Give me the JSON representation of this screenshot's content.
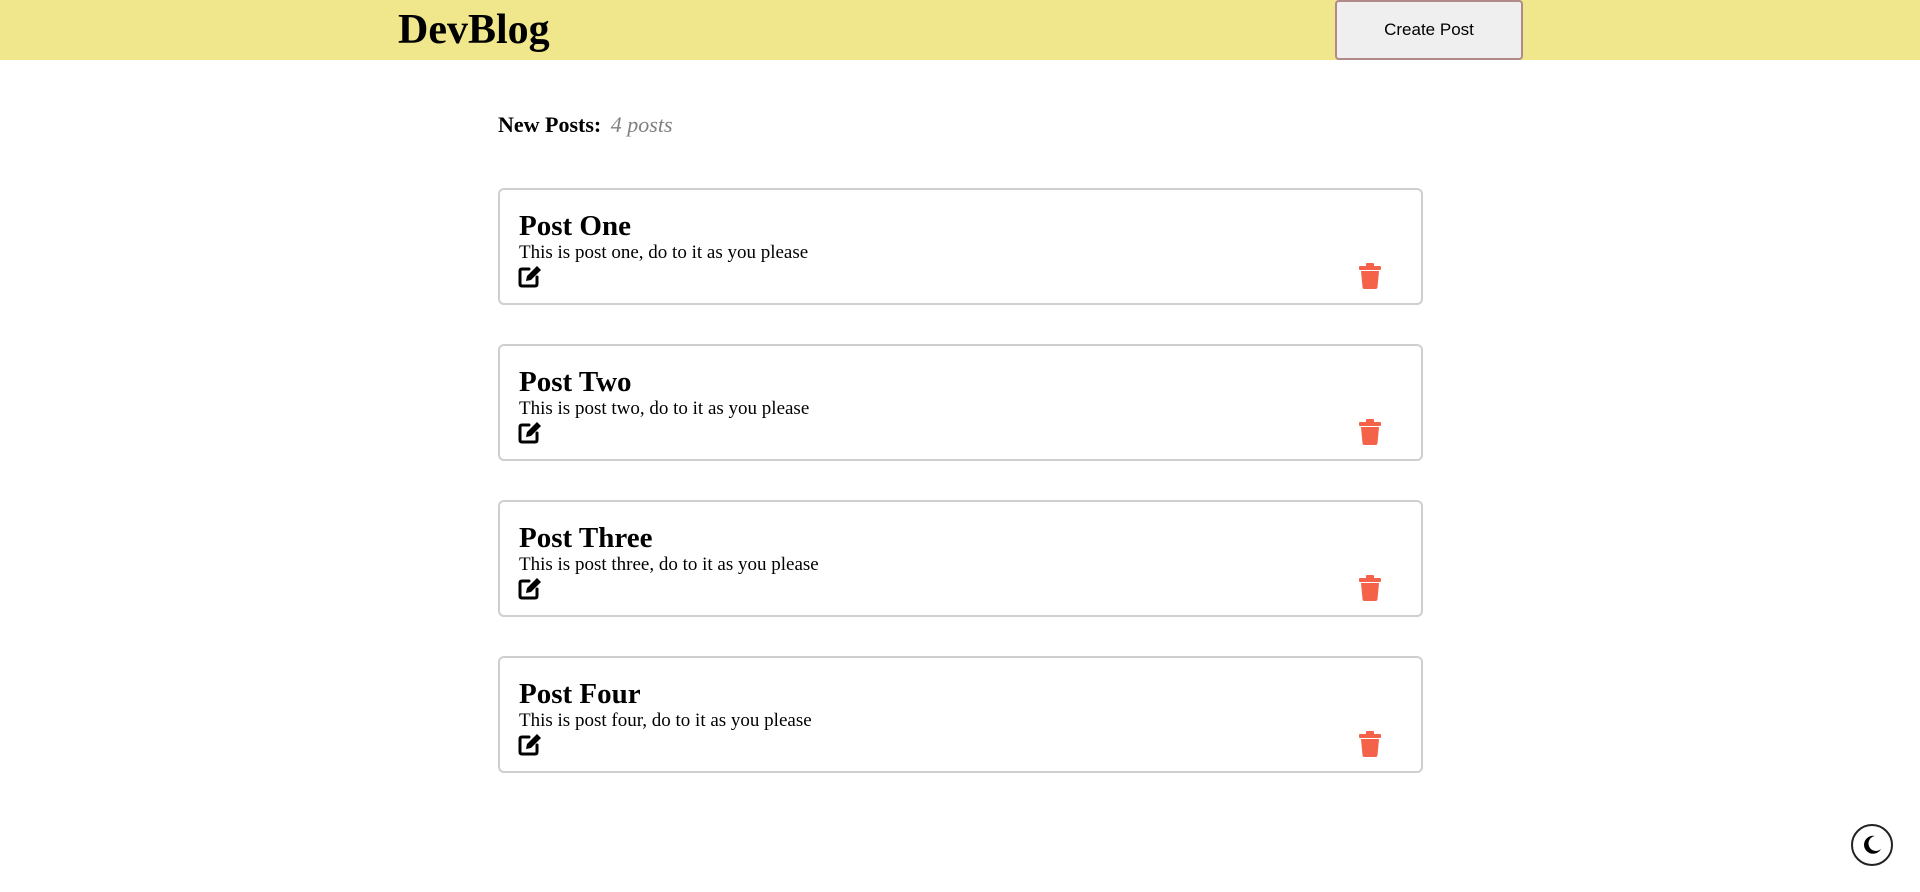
{
  "header": {
    "brand": "DevBlog",
    "create_post_label": "Create Post",
    "background_color": "#f0e68c"
  },
  "summary": {
    "label": "New Posts:",
    "count_text": "4 posts"
  },
  "posts": [
    {
      "title": "Post One",
      "body": "This is post one, do to it as you please"
    },
    {
      "title": "Post Two",
      "body": "This is post two, do to it as you please"
    },
    {
      "title": "Post Three",
      "body": "This is post three, do to it as you please"
    },
    {
      "title": "Post Four",
      "body": "This is post four, do to it as you please"
    }
  ],
  "icons": {
    "edit": "edit-icon",
    "delete": "trash-icon",
    "theme": "moon-icon"
  },
  "colors": {
    "delete_icon": "#f4624a",
    "post_border": "#cfcfcf",
    "count_text": "#808080"
  }
}
